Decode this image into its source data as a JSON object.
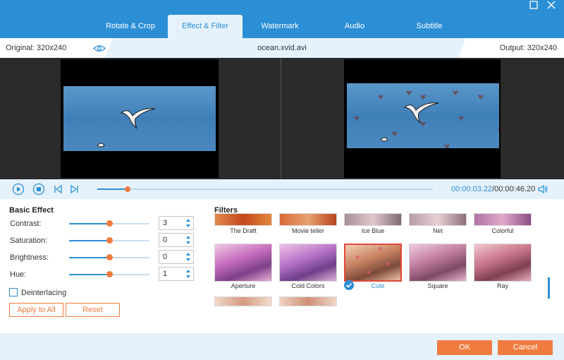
{
  "window": {
    "maximize_icon": "maximize-icon",
    "close_icon": "close-icon"
  },
  "tabs": [
    {
      "label": "Rotate & Crop"
    },
    {
      "label": "Effect & Filter",
      "active": true
    },
    {
      "label": "Watermark"
    },
    {
      "label": "Audio"
    },
    {
      "label": "Subtitle"
    }
  ],
  "info": {
    "original": "Original: 320x240",
    "filename": "ocean.xvid.avi",
    "output": "Output: 320x240"
  },
  "playback": {
    "current_time": "00:00:03.22",
    "total_time": "/00:00:46.20",
    "progress_fraction": 0.09
  },
  "basic_effect": {
    "title": "Basic Effect",
    "params": [
      {
        "label": "Contrast:",
        "value": "3",
        "level": 0.5
      },
      {
        "label": "Saturation:",
        "value": "0",
        "level": 0.5
      },
      {
        "label": "Brightness:",
        "value": "0",
        "level": 0.5
      },
      {
        "label": "Hue:",
        "value": "1",
        "level": 0.5
      }
    ],
    "deinterlacing_label": "Deinterlacing",
    "apply_all_label": "Apply to All",
    "reset_label": "Reset"
  },
  "filters": {
    "title": "Filters",
    "row1": [
      "The Draft",
      "Movie teller",
      "Ice Blue",
      "Net",
      "Colorful"
    ],
    "row2": [
      "Aperture",
      "Cold Colors",
      "Cute",
      "Square",
      "Ray"
    ],
    "selected": "Cute"
  },
  "footer": {
    "ok_label": "OK",
    "cancel_label": "Cancel"
  },
  "colors": {
    "accent_blue": "#2c8fd6",
    "accent_orange": "#f07b3f",
    "panel_bg": "#e6f2fb"
  }
}
